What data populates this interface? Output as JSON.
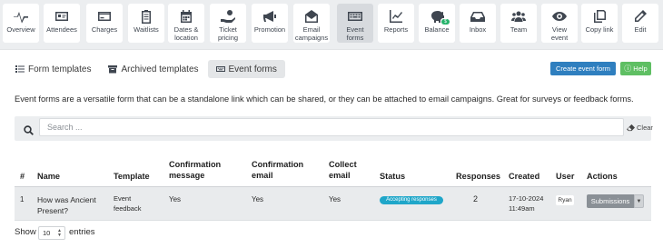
{
  "toolbar": {
    "items": [
      {
        "label": "Overview",
        "icon": "pulse-icon"
      },
      {
        "label": "Attendees",
        "icon": "id-card-icon"
      },
      {
        "label": "Charges",
        "icon": "credit-card-icon"
      },
      {
        "label": "Waitlists",
        "icon": "clipboard-list-icon"
      },
      {
        "label": "Dates &\nlocation",
        "icon": "calendar-icon"
      },
      {
        "label": "Ticket\npricing",
        "icon": "hand-coin-icon"
      },
      {
        "label": "Promotion",
        "icon": "megaphone-icon"
      },
      {
        "label": "Email\ncampaigns",
        "icon": "envelope-open-icon"
      },
      {
        "label": "Event\nforms",
        "icon": "keyboard-icon"
      },
      {
        "label": "Reports",
        "icon": "chart-line-icon"
      },
      {
        "label": "Balance",
        "icon": "piggy-bank-icon",
        "badge": "$"
      },
      {
        "label": "Inbox",
        "icon": "inbox-icon"
      },
      {
        "label": "Team",
        "icon": "users-icon"
      },
      {
        "label": "View\nevent",
        "icon": "eye-icon"
      },
      {
        "label": "Copy link",
        "icon": "copy-icon"
      },
      {
        "label": "Edit",
        "icon": "pencil-icon"
      }
    ]
  },
  "tabs": [
    {
      "label": "Form templates",
      "icon": "list-icon"
    },
    {
      "label": "Archived templates",
      "icon": "archive-icon"
    },
    {
      "label": "Event forms",
      "icon": "keyboard-icon"
    }
  ],
  "buttons": {
    "create": "Create event form",
    "help": "Help"
  },
  "description": "Event forms are a versatile form that can be a standalone link which can be shared, or they can be attached to email campaigns. Great for surveys or feedback forms.",
  "search": {
    "placeholder": "Search ...",
    "value": "",
    "clear": "Clear"
  },
  "table": {
    "headers": {
      "num": "#",
      "name": "Name",
      "template": "Template",
      "conf_msg": "Confirmation\nmessage",
      "conf_email": "Confirmation\nemail",
      "collect": "Collect\nemail",
      "status": "Status",
      "responses": "Responses",
      "created": "Created",
      "user": "User",
      "actions": "Actions"
    },
    "rows": [
      {
        "num": "1",
        "name": "How was Ancient\nPresent?",
        "template": "Event\nfeedback",
        "conf_msg": "Yes",
        "conf_email": "Yes",
        "collect": "Yes",
        "status": "Accepting responses",
        "responses": "2",
        "created": "17-10-2024\n11:49am",
        "user": "Ryan",
        "action": "Submissions"
      }
    ]
  },
  "footer": {
    "show": "Show",
    "entries_value": "10",
    "entries": "entries"
  },
  "colors": {
    "accent": "#2f7fbf",
    "help": "#5fbf63",
    "status": "#1fa6c9",
    "badge": "#26b36b"
  }
}
